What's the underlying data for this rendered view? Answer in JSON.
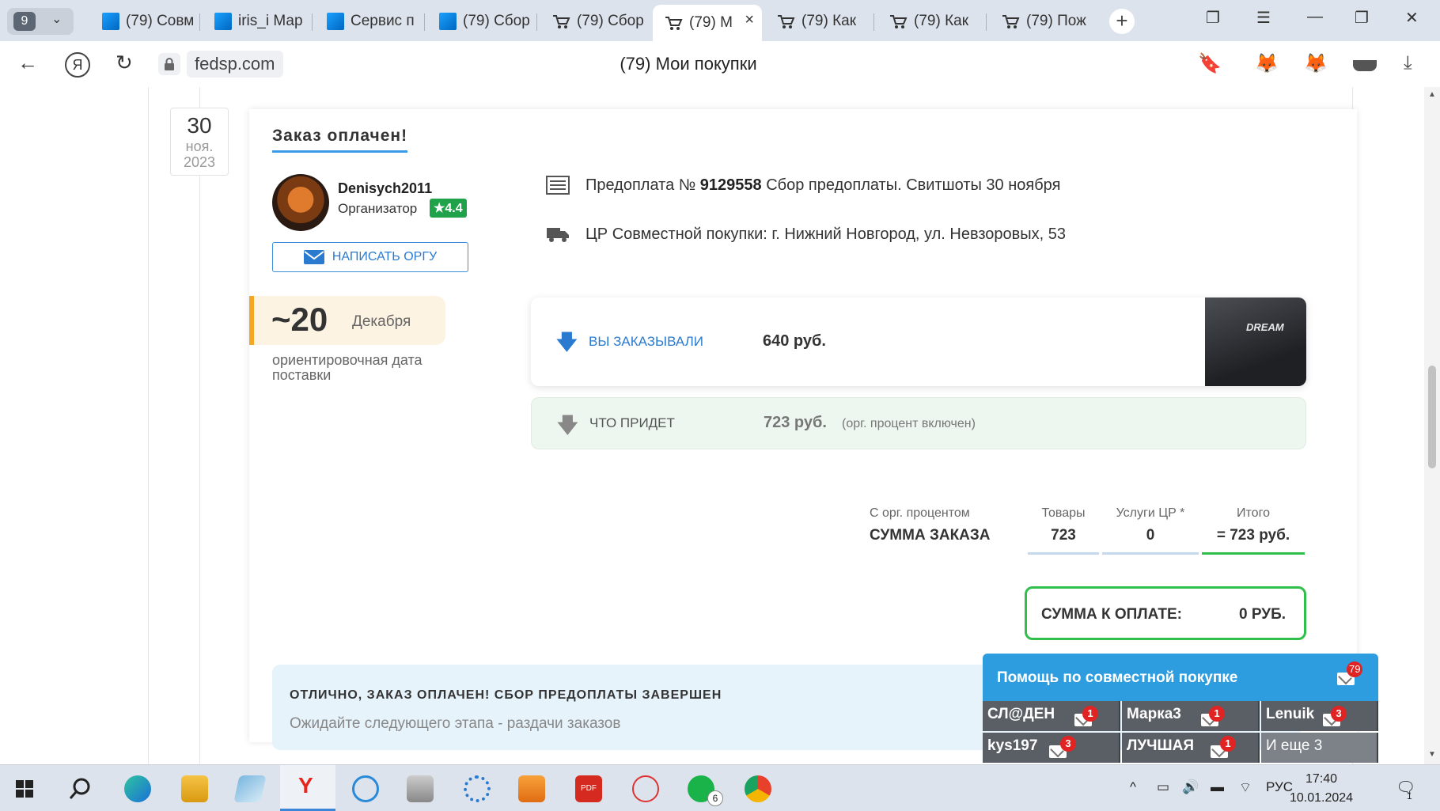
{
  "browser": {
    "tab_count": "9",
    "tabs": [
      {
        "title": "(79) Совм",
        "icon": "windows-tile"
      },
      {
        "title": "iris_i Мар",
        "icon": "windows-tile"
      },
      {
        "title": "Сервис п",
        "icon": "windows-tile"
      },
      {
        "title": "(79) Сбор",
        "icon": "windows-tile"
      },
      {
        "title": "(79) Сбор",
        "icon": "cart"
      },
      {
        "title": "(79) М",
        "icon": "cart",
        "active": true
      },
      {
        "title": "(79) Как",
        "icon": "cart"
      },
      {
        "title": "(79) Как",
        "icon": "cart"
      },
      {
        "title": "(79) Пож",
        "icon": "cart"
      }
    ],
    "url": "fedsp.com",
    "page_title": "(79) Мои покупки"
  },
  "order": {
    "date_day": "30",
    "date_month": "ноя.",
    "date_year": "2023",
    "status_title": "Заказ оплачен!",
    "organizer_name": "Denisych2011",
    "organizer_role": "Организатор",
    "organizer_rating": "★4.4",
    "write_button": "НАПИСАТЬ ОРГУ",
    "delivery_day": "~20",
    "delivery_month": "Декабря",
    "delivery_note": "ориентировочная дата поставки",
    "prepay_prefix": "Предоплата №",
    "prepay_number": "9129558",
    "prepay_text": "Сбор предоплаты. Свитшоты 30 ноября",
    "pickup_text": "ЦР Совместной покупки: г. Нижний Новгород, ул. Невзоровых, 53",
    "ordered_label": "ВЫ ЗАКАЗЫВАЛИ",
    "ordered_amount": "640 руб.",
    "product_print": "DREAM",
    "coming_label": "ЧТО ПРИДЕТ",
    "coming_amount": "723 руб.",
    "coming_note": "(орг. процент включен)",
    "sum_caption": "С орг. процентом",
    "sum_title": "СУММА ЗАКАЗА",
    "goods_label": "Товары",
    "goods_value": "723",
    "services_label": "Услуги ЦР *",
    "services_value": "0",
    "total_label": "Итого",
    "total_value": "= 723 руб.",
    "to_pay_label": "СУММА К ОПЛАТЕ:",
    "to_pay_value": "0 РУБ.",
    "notice_title": "ОТЛИЧНО, ЗАКАЗ ОПЛАЧЕН! СБОР ПРЕДОПЛАТЫ ЗАВЕРШЕН",
    "notice_text": "Ожидайте следующего этапа - раздачи заказов"
  },
  "help_widget": {
    "title": "Помощь по совместной покупке",
    "badge": "79",
    "chats": [
      {
        "name": "СЛ@ДЕН",
        "badge": "1"
      },
      {
        "name": "Марка3",
        "badge": "1"
      },
      {
        "name": "Lenuik",
        "badge": "3"
      },
      {
        "name": "kys197",
        "badge": "3"
      },
      {
        "name": "ЛУЧШАЯ",
        "badge": "1"
      },
      {
        "name": "И еще 3",
        "badge": ""
      }
    ]
  },
  "taskbar": {
    "whatsapp_badge": "6",
    "language": "РУС",
    "time": "17:40",
    "date": "10.01.2024",
    "notifications": "1"
  },
  "colors": {
    "accent_blue": "#2e9de0",
    "green": "#2fbf4a",
    "orange": "#f5a623",
    "badge_red": "#e02424"
  }
}
